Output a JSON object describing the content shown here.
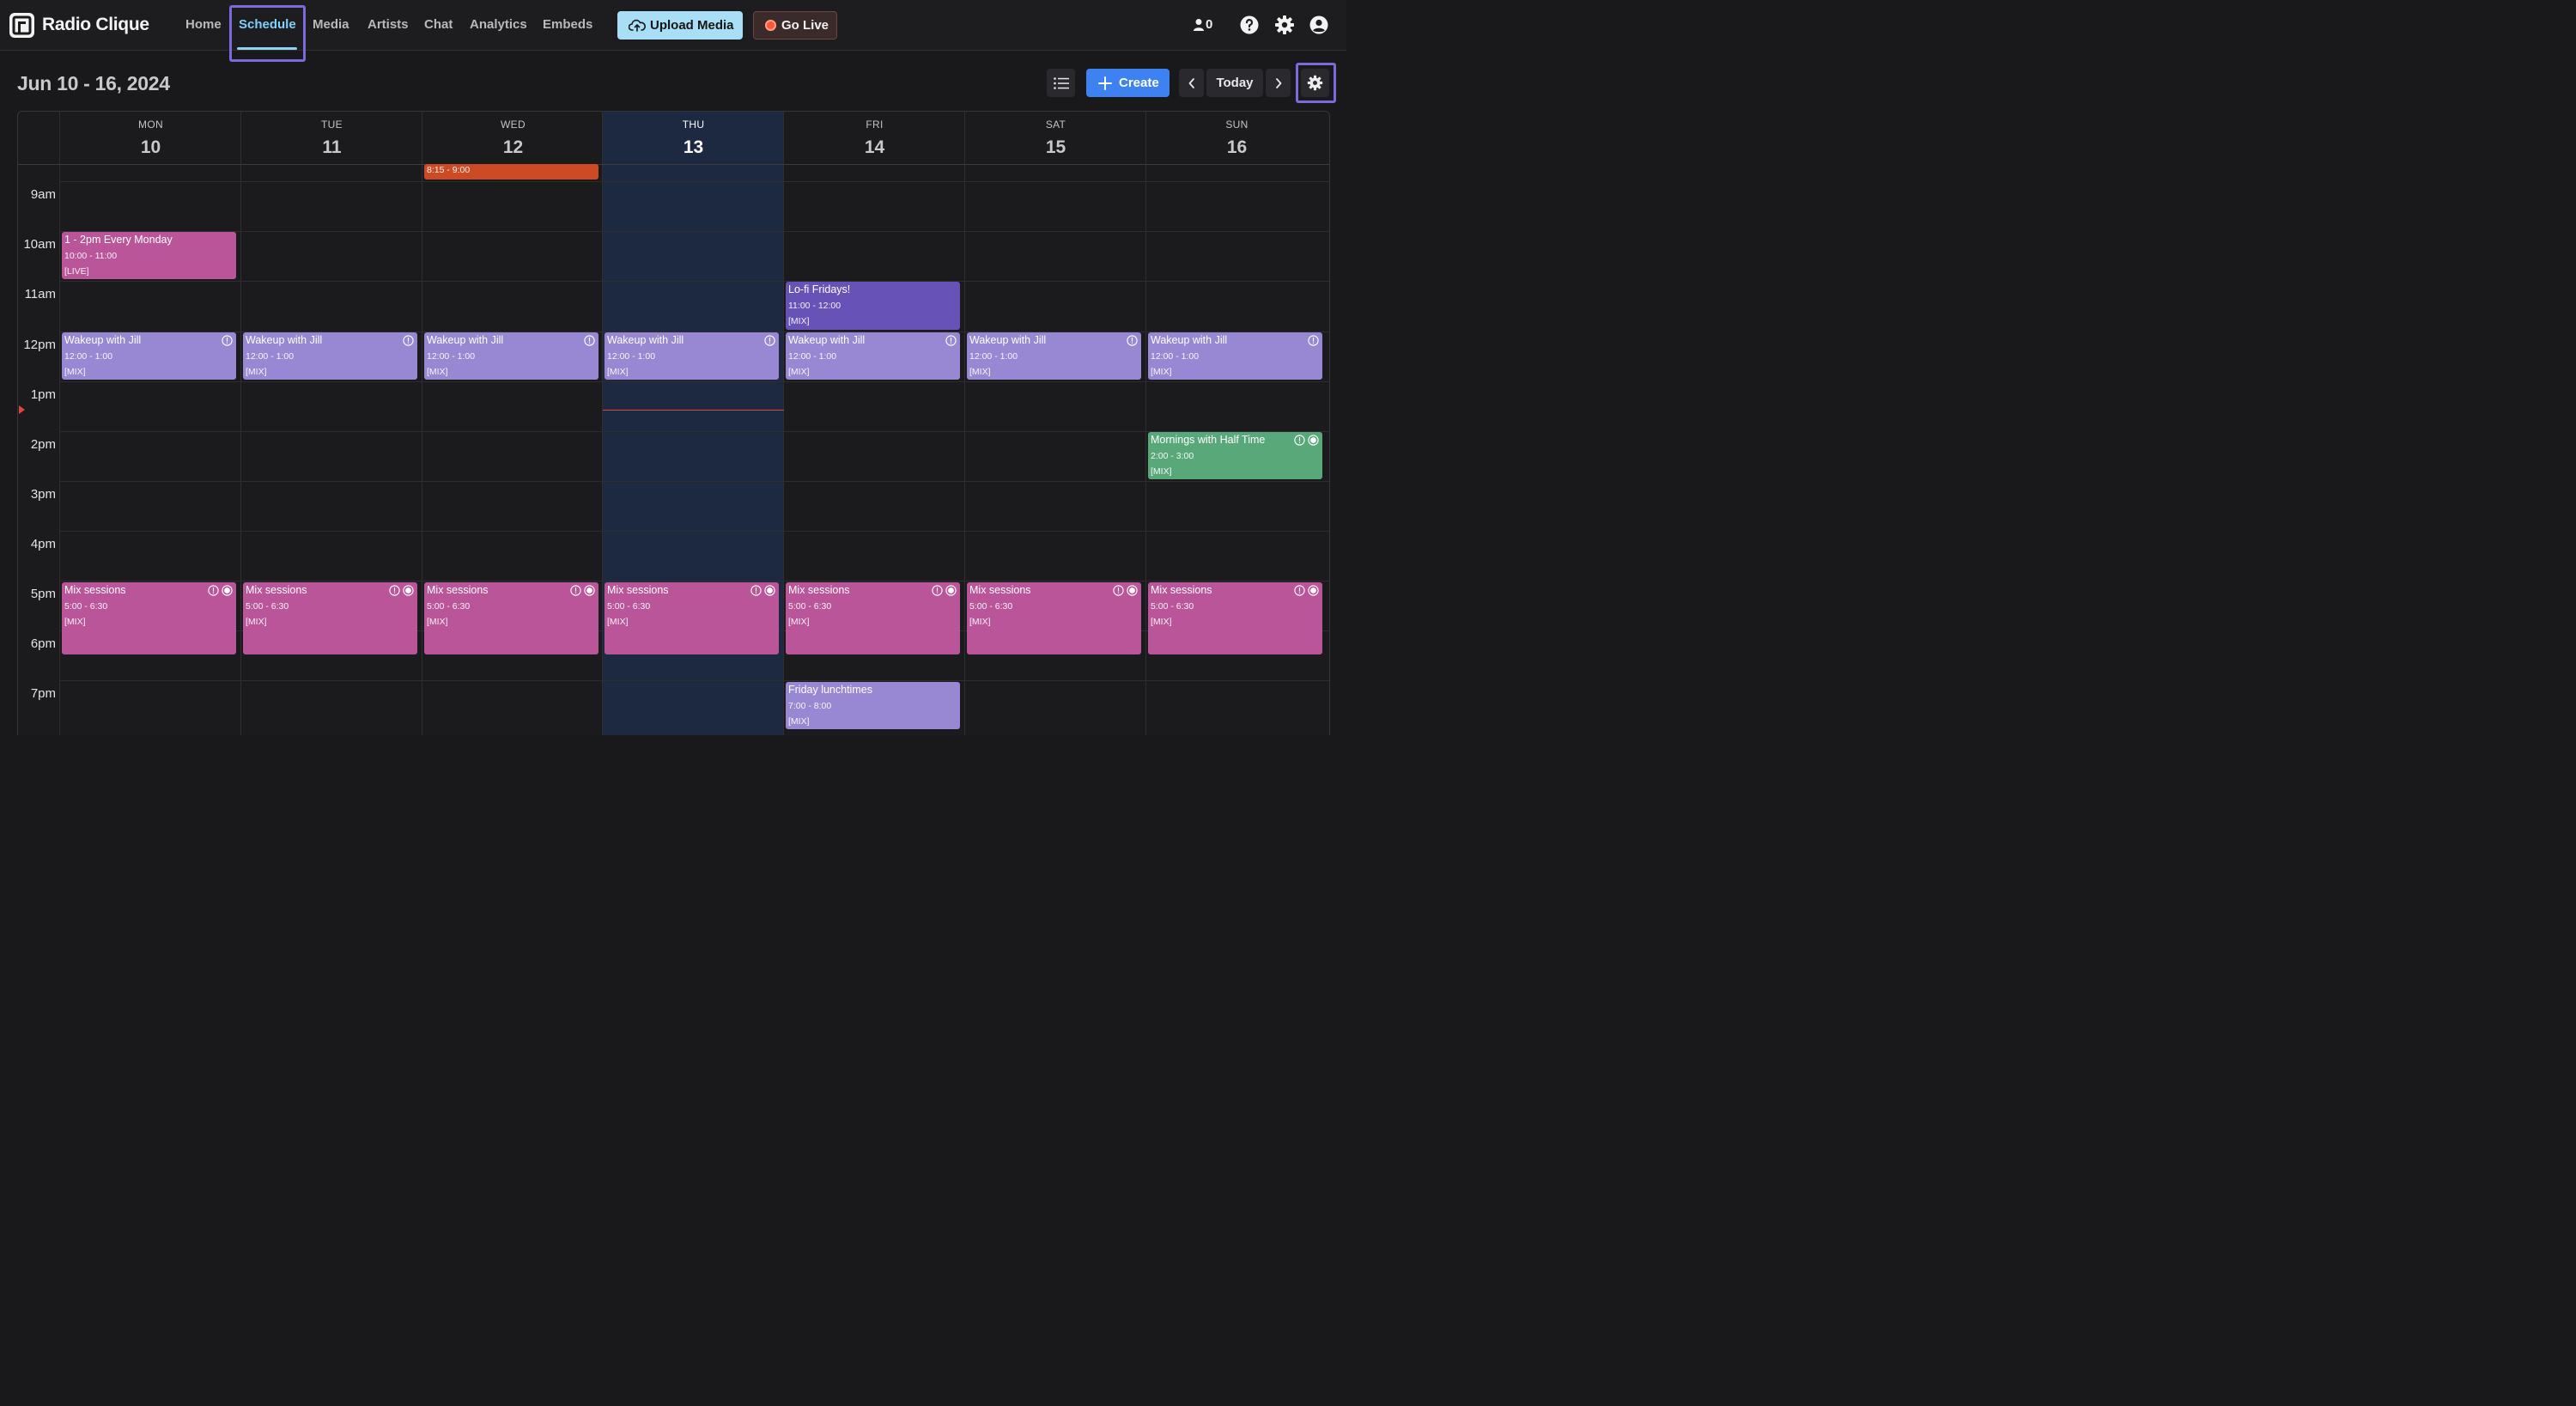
{
  "app": {
    "title": "Radio Clique"
  },
  "nav": [
    {
      "label": "Home",
      "active": false
    },
    {
      "label": "Schedule",
      "active": true
    },
    {
      "label": "Media",
      "active": false
    },
    {
      "label": "Artists",
      "active": false
    },
    {
      "label": "Chat",
      "active": false
    },
    {
      "label": "Analytics",
      "active": false
    },
    {
      "label": "Embeds",
      "active": false
    }
  ],
  "actions": {
    "upload": "Upload Media",
    "golive": "Go Live"
  },
  "user_area": {
    "listeners": "0",
    "icons": [
      "listener-icon",
      "help-icon",
      "settings-icon",
      "account-icon"
    ]
  },
  "toolbar": {
    "range": "Jun 10 - 16, 2024",
    "create": "Create",
    "today": "Today"
  },
  "calendar": {
    "days": [
      {
        "name": "MON",
        "date": "10"
      },
      {
        "name": "TUE",
        "date": "11"
      },
      {
        "name": "WED",
        "date": "12"
      },
      {
        "name": "THU",
        "date": "13",
        "today": true
      },
      {
        "name": "FRI",
        "date": "14"
      },
      {
        "name": "SAT",
        "date": "15"
      },
      {
        "name": "SUN",
        "date": "16"
      }
    ],
    "hours": [
      "9am",
      "10am",
      "11am",
      "12pm",
      "1pm",
      "2pm",
      "3pm",
      "4pm",
      "5pm",
      "6pm",
      "7pm"
    ],
    "events": [
      {
        "day": 2,
        "title": "",
        "time": "8:15 - 9:00",
        "tag": "",
        "color": "orange"
      },
      {
        "day": 0,
        "title": "1 - 2pm Every Monday",
        "time": "10:00 - 11:00",
        "tag": "[LIVE]",
        "color": "pink"
      },
      {
        "day": 4,
        "title": "Lo-fi Fridays!",
        "time": "11:00 - 12:00",
        "tag": "[MIX]",
        "color": "purple"
      },
      {
        "day": 0,
        "title": "Wakeup with Jill",
        "time": "12:00 - 1:00",
        "tag": "[MIX]",
        "color": "lavender",
        "warn": true
      },
      {
        "day": 1,
        "title": "Wakeup with Jill",
        "time": "12:00 - 1:00",
        "tag": "[MIX]",
        "color": "lavender",
        "warn": true
      },
      {
        "day": 2,
        "title": "Wakeup with Jill",
        "time": "12:00 - 1:00",
        "tag": "[MIX]",
        "color": "lavender",
        "warn": true
      },
      {
        "day": 3,
        "title": "Wakeup with Jill",
        "time": "12:00 - 1:00",
        "tag": "[MIX]",
        "color": "lavender",
        "warn": true
      },
      {
        "day": 4,
        "title": "Wakeup with Jill",
        "time": "12:00 - 1:00",
        "tag": "[MIX]",
        "color": "lavender",
        "warn": true
      },
      {
        "day": 5,
        "title": "Wakeup with Jill",
        "time": "12:00 - 1:00",
        "tag": "[MIX]",
        "color": "lavender",
        "warn": true
      },
      {
        "day": 6,
        "title": "Wakeup with Jill",
        "time": "12:00 - 1:00",
        "tag": "[MIX]",
        "color": "lavender",
        "warn": true
      },
      {
        "day": 6,
        "title": "Mornings with Half Time",
        "time": "2:00 - 3:00",
        "tag": "[MIX]",
        "color": "green",
        "warn": true,
        "repeat": true
      },
      {
        "day": 0,
        "title": "Mix sessions",
        "time": "5:00 - 6:30",
        "tag": "[MIX]",
        "color": "pink",
        "warn": true,
        "repeat": true
      },
      {
        "day": 1,
        "title": "Mix sessions",
        "time": "5:00 - 6:30",
        "tag": "[MIX]",
        "color": "pink",
        "warn": true,
        "repeat": true
      },
      {
        "day": 2,
        "title": "Mix sessions",
        "time": "5:00 - 6:30",
        "tag": "[MIX]",
        "color": "pink",
        "warn": true,
        "repeat": true
      },
      {
        "day": 3,
        "title": "Mix sessions",
        "time": "5:00 - 6:30",
        "tag": "[MIX]",
        "color": "pink",
        "warn": true,
        "repeat": true
      },
      {
        "day": 4,
        "title": "Mix sessions",
        "time": "5:00 - 6:30",
        "tag": "[MIX]",
        "color": "pink",
        "warn": true,
        "repeat": true
      },
      {
        "day": 5,
        "title": "Mix sessions",
        "time": "5:00 - 6:30",
        "tag": "[MIX]",
        "color": "pink",
        "warn": true,
        "repeat": true
      },
      {
        "day": 6,
        "title": "Mix sessions",
        "time": "5:00 - 6:30",
        "tag": "[MIX]",
        "color": "pink",
        "warn": true,
        "repeat": true
      },
      {
        "day": 4,
        "title": "Friday lunchtimes",
        "time": "7:00 - 8:00",
        "tag": "[MIX]",
        "color": "lavender"
      }
    ]
  },
  "colors": {
    "pink": "#b95598",
    "lavender": "#9887d2",
    "purple": "#6753b8",
    "green": "#58a87a",
    "orange": "#cc4a24",
    "accent": "#3d82f0",
    "today_column": "#1c2940",
    "now_line": "#e0463a"
  }
}
